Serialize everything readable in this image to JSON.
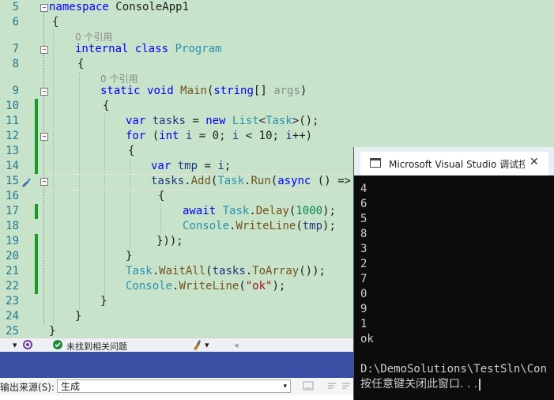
{
  "editor": {
    "line_numbers": [
      "5",
      "6",
      "7",
      "8",
      "9",
      "10",
      "11",
      "12",
      "13",
      "14",
      "15",
      "16",
      "17",
      "18",
      "19",
      "20",
      "21",
      "22",
      "23",
      "24",
      "25"
    ],
    "codelens": [
      "0 个引用",
      "0 个引用"
    ],
    "lines": {
      "l5": [
        "namespace",
        " ConsoleApp1"
      ],
      "l6": [
        "{"
      ],
      "l7": [
        "internal",
        " ",
        "class",
        " ",
        "Program"
      ],
      "l8": [
        "{"
      ],
      "l9": [
        "static",
        " ",
        "void",
        " ",
        "Main",
        "(",
        "string",
        "[] ",
        "args",
        ")"
      ],
      "l10": [
        "{"
      ],
      "l11": [
        "var",
        " ",
        "tasks",
        " = ",
        "new",
        " ",
        "List",
        "<",
        "Task",
        ">();"
      ],
      "l12": [
        "for",
        " (",
        "int",
        " ",
        "i",
        " = ",
        "0",
        "; ",
        "i",
        " < ",
        "10",
        "; ",
        "i",
        "++)"
      ],
      "l13": [
        "{"
      ],
      "l14": [
        "var",
        " ",
        "tmp",
        " = ",
        "i",
        ";"
      ],
      "l15": [
        "tasks",
        ".",
        "Add",
        "(",
        "Task",
        ".",
        "Run",
        "(",
        "async",
        " () =>"
      ],
      "l16": [
        "{"
      ],
      "l17": [
        "await",
        " ",
        "Task",
        ".",
        "Delay",
        "(",
        "1000",
        ");"
      ],
      "l18": [
        "Console",
        ".",
        "WriteLine",
        "(",
        "tmp",
        ");"
      ],
      "l19": [
        "}));"
      ],
      "l20": [
        "}"
      ],
      "l21": [
        "Task",
        ".",
        "WaitAll",
        "(",
        "tasks",
        ".",
        "ToArray",
        "());"
      ],
      "l22": [
        "Console",
        ".",
        "WriteLine",
        "(",
        "\"ok\"",
        ");"
      ],
      "l23": [
        "}"
      ],
      "l24": [
        "}"
      ],
      "l25": [
        "}"
      ]
    }
  },
  "statusbar": {
    "dropdown_caret": "▾",
    "issues_text": "未找到相关问题",
    "brush_caret": "▾",
    "nav_left": "◂"
  },
  "output_panel": {
    "source_label": "输出来源(S):",
    "source_value": "生成",
    "source_caret": "▾"
  },
  "console_window": {
    "title": "Microsoft Visual Studio 调试控制台",
    "close_glyph": "✕",
    "output_lines": [
      "4",
      "6",
      "5",
      "8",
      "3",
      "2",
      "7",
      "0",
      "9",
      "1",
      "ok",
      "",
      "D:\\DemoSolutions\\TestSln\\Con",
      "按任意键关闭此窗口. . ."
    ]
  },
  "colors": {
    "editor_bg": "#c7e3c9",
    "keyword": "#0000ff",
    "type": "#2b91af",
    "method": "#74531f",
    "console_bg": "#0c0c0c",
    "change_bar": "#169b2a"
  }
}
